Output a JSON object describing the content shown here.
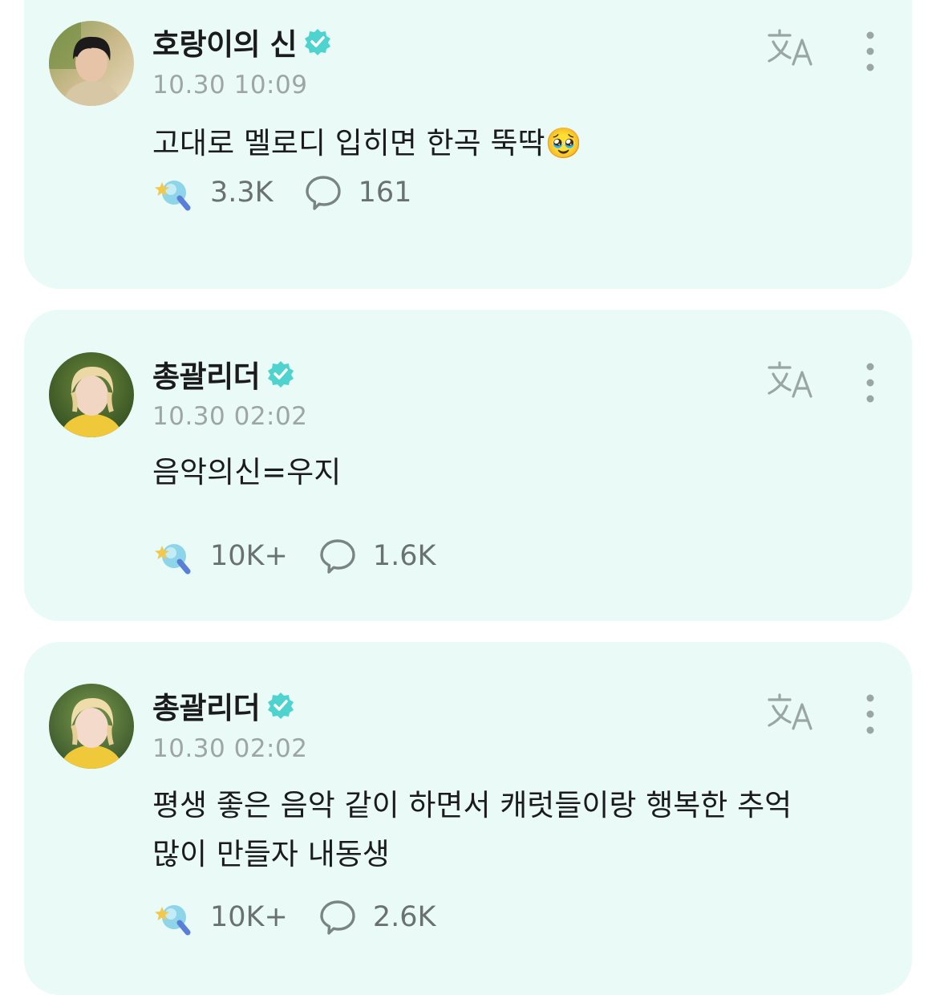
{
  "colors": {
    "card_background": "#e9faf7",
    "verified_badge": "#4fd3cf",
    "username_text": "#1b1b1b",
    "timestamp_text": "#9ea6a4",
    "stat_text": "#6a7270"
  },
  "icons": {
    "verified": "verified-badge-icon",
    "translate": "translate-icon",
    "more": "more-vertical-icon",
    "reactions": "lightstick-reaction-icon",
    "comments": "comment-bubble-icon"
  },
  "posts": [
    {
      "author": "호랑이의 신",
      "timestamp": "10.30 10:09",
      "lines": [
        "고대로 멜로디 입히면 한곡 뚝딱🥹"
      ],
      "reactions": "3.3K",
      "comments": "161"
    },
    {
      "author": "총괄리더",
      "timestamp": "10.30 02:02",
      "lines": [
        "음악의신=우지"
      ],
      "reactions": "10K+",
      "comments": "1.6K"
    },
    {
      "author": "총괄리더",
      "timestamp": "10.30 02:02",
      "lines": [
        "평생 좋은 음악 같이 하면서 캐럿들이랑 행복한 추억",
        "많이 만들자 내동생"
      ],
      "reactions": "10K+",
      "comments": "2.6K"
    }
  ]
}
